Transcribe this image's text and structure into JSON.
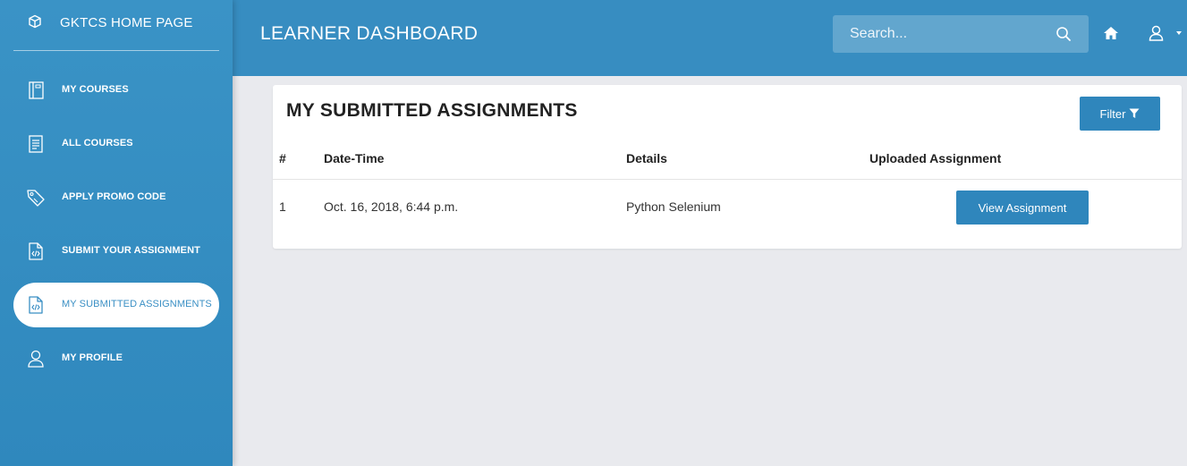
{
  "brand": {
    "label": "GKTCS HOME PAGE",
    "icon": "cube-icon"
  },
  "sidebar": {
    "items": [
      {
        "label": "MY COURSES",
        "icon": "book-icon",
        "active": false
      },
      {
        "label": "ALL COURSES",
        "icon": "document-list-icon",
        "active": false
      },
      {
        "label": "APPLY PROMO CODE",
        "icon": "tag-icon",
        "active": false
      },
      {
        "label": "SUBMIT YOUR ASSIGNMENT",
        "icon": "code-file-icon",
        "active": false
      },
      {
        "label": "MY SUBMITTED ASSIGNMENTS",
        "icon": "code-file-icon",
        "active": true
      },
      {
        "label": "MY PROFILE",
        "icon": "user-icon",
        "active": false
      }
    ]
  },
  "header": {
    "title": "LEARNER DASHBOARD",
    "search_placeholder": "Search..."
  },
  "card": {
    "title": "MY SUBMITTED ASSIGNMENTS",
    "filter_label": "Filter"
  },
  "table": {
    "headers": [
      "#",
      "Date-Time",
      "Details",
      "Uploaded Assignment"
    ],
    "rows": [
      {
        "index": "1",
        "datetime": "Oct. 16, 2018, 6:44 p.m.",
        "details": "Python Selenium",
        "action_label": "View Assignment"
      }
    ]
  },
  "colors": {
    "primary": "#378dc1",
    "button": "#2f86bc",
    "background": "#e9eaee",
    "active_text": "#3a8fc4"
  }
}
